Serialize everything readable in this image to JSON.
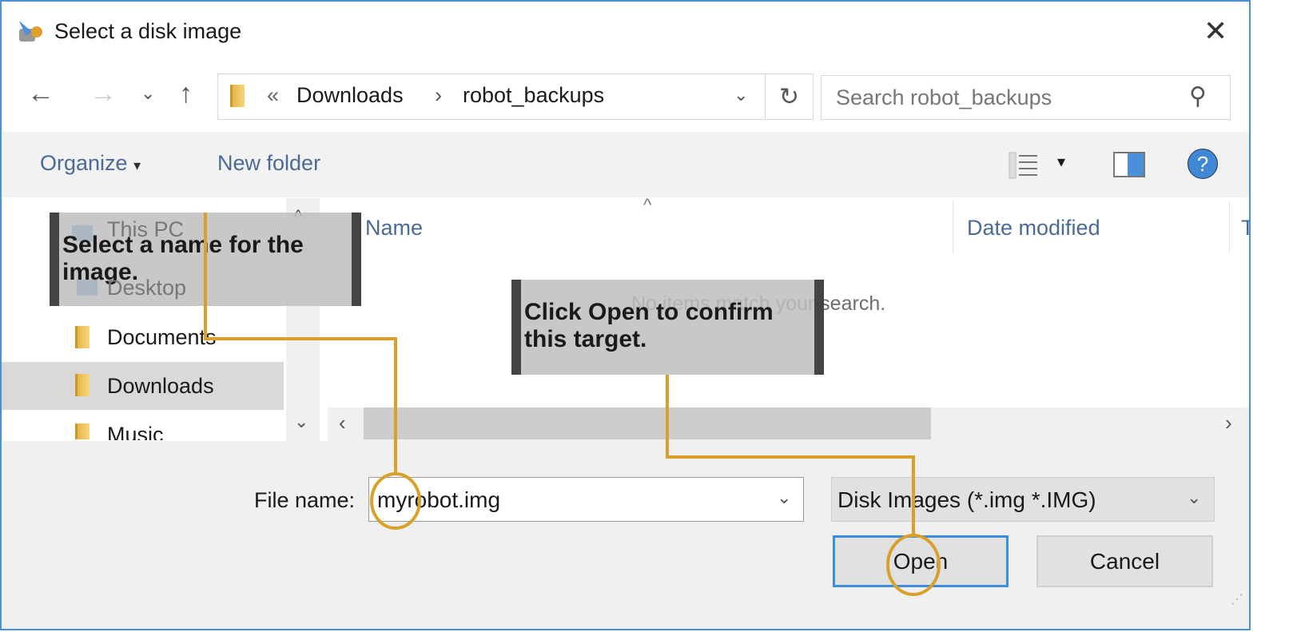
{
  "window": {
    "title": "Select a disk image",
    "close_label": "✕"
  },
  "nav": {
    "back": "←",
    "forward": "→",
    "recent": "⌄",
    "up": "↑",
    "breadcrumb": {
      "overflow": "«",
      "items": [
        "Downloads",
        "robot_backups"
      ],
      "separator": "›"
    },
    "refresh": "↻",
    "search_placeholder": "Search robot_backups"
  },
  "toolbar": {
    "organize": "Organize",
    "organize_caret": "▾",
    "new_folder": "New folder",
    "view_caret": "▾",
    "help": "?"
  },
  "sidebar": {
    "items": [
      {
        "label": "This PC",
        "icon": "computer-icon"
      },
      {
        "label": "Desktop",
        "icon": "desktop-icon"
      },
      {
        "label": "Documents",
        "icon": "documents-folder-icon"
      },
      {
        "label": "Downloads",
        "icon": "downloads-folder-icon",
        "selected": true
      },
      {
        "label": "Music",
        "icon": "music-folder-icon"
      }
    ]
  },
  "filelist": {
    "columns": [
      "Name",
      "Date modified",
      "T"
    ],
    "sort_caret": "^",
    "empty_message": "No items match your search."
  },
  "bottom": {
    "file_name_label": "File name:",
    "file_name_value": "myrobot.img",
    "filter_value": "Disk Images (*.img *.IMG)",
    "open": "Open",
    "cancel": "Cancel"
  },
  "callouts": [
    "Select a name for the image.",
    "Click Open to confirm this target."
  ],
  "colors": {
    "accent": "#4a90d9",
    "annotation": "#d9a02a",
    "selected_row": "#d9d9d9"
  }
}
